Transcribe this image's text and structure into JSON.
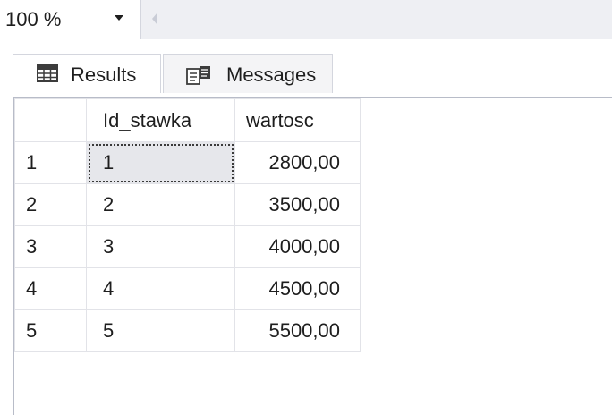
{
  "toolbar": {
    "zoom_value": "100 %"
  },
  "tabs": [
    {
      "label": "Results",
      "icon": "grid-icon",
      "active": true
    },
    {
      "label": "Messages",
      "icon": "messages-icon",
      "active": false
    }
  ],
  "grid": {
    "columns": [
      "",
      "Id_stawka",
      "wartosc"
    ],
    "rows": [
      {
        "row_num": "1",
        "id_stawka": "1",
        "wartosc": "2800,00"
      },
      {
        "row_num": "2",
        "id_stawka": "2",
        "wartosc": "3500,00"
      },
      {
        "row_num": "3",
        "id_stawka": "3",
        "wartosc": "4000,00"
      },
      {
        "row_num": "4",
        "id_stawka": "4",
        "wartosc": "4500,00"
      },
      {
        "row_num": "5",
        "id_stawka": "5",
        "wartosc": "5500,00"
      }
    ]
  }
}
